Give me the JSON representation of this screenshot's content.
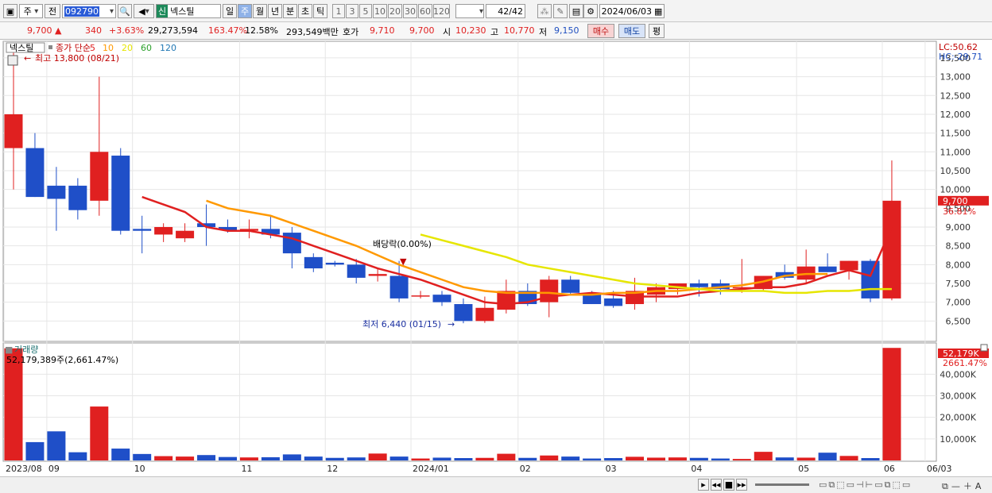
{
  "toolbar": {
    "mode": "주",
    "prev_label": "전",
    "code": "092790",
    "badge": "신",
    "name": "넥스틸",
    "periods": [
      "일",
      "주",
      "월",
      "년",
      "분",
      "초",
      "틱"
    ],
    "active_period": "주",
    "numbers": [
      "1",
      "3",
      "5",
      "10",
      "20",
      "30",
      "60",
      "120"
    ],
    "count": "42",
    "count_total": "/42",
    "date": "2024/06/03"
  },
  "quote": {
    "price": "9,700",
    "change": "340",
    "change_pct": "+3.63%",
    "volume": "29,273,594",
    "vol_ratio": "163.47%",
    "turnover": "12.58%",
    "amount": "293,549백만",
    "hoga_label": "호가",
    "hoga1": "9,710",
    "hoga2": "9,700",
    "open_label": "시",
    "open": "10,230",
    "high_label": "고",
    "high": "10,770",
    "low_label": "저",
    "low": "9,150",
    "buy": "매수",
    "sell": "매도",
    "eval": "평"
  },
  "legend": {
    "name": "넥스틸",
    "ma_label": "종가 단순",
    "ma_periods": [
      "5",
      "10",
      "20",
      "60",
      "120"
    ],
    "ma_colors": [
      "#e02020",
      "#ff9900",
      "#e6e600",
      "#2ca02c",
      "#1f77b4"
    ],
    "high_note": "최고 13,800 (08/21)",
    "low_note": "최저 6,440 (01/15)",
    "dividend": "배당락(0.00%)",
    "lc": "LC:50.62",
    "hc": "HC:-29.71",
    "last_price": "9,700",
    "last_pct": "36.81%"
  },
  "volume_panel": {
    "title": "거래량",
    "value": "52,179,389주(2,661.47%)",
    "last": "52,179K",
    "last_pct": "2661.47%"
  },
  "chart_data": {
    "type": "candlestick",
    "price_ticks": [
      "13,500",
      "13,000",
      "12,500",
      "12,000",
      "11,500",
      "11,000",
      "10,500",
      "10,000",
      "9,500",
      "9,000",
      "8,500",
      "8,000",
      "7,500",
      "7,000",
      "6,500"
    ],
    "price_values": [
      13500,
      13000,
      12500,
      12000,
      11500,
      11000,
      10500,
      10000,
      9500,
      9000,
      8500,
      8000,
      7500,
      7000,
      6500
    ],
    "ylim": [
      6000,
      13900
    ],
    "vol_ticks": [
      "40,000K",
      "30,000K",
      "20,000K",
      "10,000K"
    ],
    "vol_values": [
      40000,
      30000,
      20000,
      10000
    ],
    "vol_max": 53000,
    "x_labels": [
      {
        "i": 0,
        "t": "2023/08"
      },
      {
        "i": 2,
        "t": "09"
      },
      {
        "i": 6,
        "t": "10"
      },
      {
        "i": 11,
        "t": "11"
      },
      {
        "i": 15,
        "t": "12"
      },
      {
        "i": 19,
        "t": "2024/01"
      },
      {
        "i": 24,
        "t": "02"
      },
      {
        "i": 28,
        "t": "03"
      },
      {
        "i": 32,
        "t": "04"
      },
      {
        "i": 37,
        "t": "05"
      },
      {
        "i": 41,
        "t": "06"
      },
      {
        "i": 43,
        "t": "06/03"
      }
    ],
    "candles": [
      {
        "o": 11100,
        "h": 13800,
        "l": 10000,
        "c": 12000,
        "v": 52000
      },
      {
        "o": 11100,
        "h": 11500,
        "l": 9800,
        "c": 9800,
        "v": 8500
      },
      {
        "o": 10100,
        "h": 10600,
        "l": 8900,
        "c": 9750,
        "v": 13500
      },
      {
        "o": 10100,
        "h": 10300,
        "l": 9200,
        "c": 9450,
        "v": 3800
      },
      {
        "o": 9700,
        "h": 13000,
        "l": 9300,
        "c": 11000,
        "v": 25000
      },
      {
        "o": 10900,
        "h": 11100,
        "l": 8800,
        "c": 8900,
        "v": 5500
      },
      {
        "o": 8950,
        "h": 9300,
        "l": 8300,
        "c": 8900,
        "v": 3000
      },
      {
        "o": 8800,
        "h": 9100,
        "l": 8600,
        "c": 9000,
        "v": 2000
      },
      {
        "o": 8700,
        "h": 9100,
        "l": 8600,
        "c": 8900,
        "v": 1800
      },
      {
        "o": 9100,
        "h": 9600,
        "l": 8500,
        "c": 9000,
        "v": 2500
      },
      {
        "o": 9000,
        "h": 9200,
        "l": 8850,
        "c": 8920,
        "v": 1600
      },
      {
        "o": 8900,
        "h": 9200,
        "l": 8700,
        "c": 8950,
        "v": 1400
      },
      {
        "o": 8950,
        "h": 9300,
        "l": 8700,
        "c": 8800,
        "v": 1500
      },
      {
        "o": 8850,
        "h": 9000,
        "l": 7900,
        "c": 8300,
        "v": 2800
      },
      {
        "o": 8200,
        "h": 8300,
        "l": 7800,
        "c": 7900,
        "v": 1800
      },
      {
        "o": 8050,
        "h": 8100,
        "l": 7950,
        "c": 8000,
        "v": 1200
      },
      {
        "o": 8000,
        "h": 8150,
        "l": 7500,
        "c": 7650,
        "v": 1400
      },
      {
        "o": 7700,
        "h": 7900,
        "l": 7550,
        "c": 7750,
        "v": 3200
      },
      {
        "o": 7700,
        "h": 8100,
        "l": 7000,
        "c": 7100,
        "v": 1800
      },
      {
        "o": 7150,
        "h": 7300,
        "l": 7100,
        "c": 7180,
        "v": 900
      },
      {
        "o": 7200,
        "h": 7300,
        "l": 6900,
        "c": 7000,
        "v": 1300
      },
      {
        "o": 6950,
        "h": 7100,
        "l": 6440,
        "c": 6500,
        "v": 1100
      },
      {
        "o": 6500,
        "h": 7150,
        "l": 6450,
        "c": 6850,
        "v": 1200
      },
      {
        "o": 6800,
        "h": 7600,
        "l": 6700,
        "c": 7300,
        "v": 3100
      },
      {
        "o": 7300,
        "h": 7500,
        "l": 6900,
        "c": 6950,
        "v": 1200
      },
      {
        "o": 7000,
        "h": 7700,
        "l": 6600,
        "c": 7600,
        "v": 2300
      },
      {
        "o": 7600,
        "h": 7700,
        "l": 7200,
        "c": 7250,
        "v": 1800
      },
      {
        "o": 7200,
        "h": 7300,
        "l": 6950,
        "c": 6950,
        "v": 900
      },
      {
        "o": 7100,
        "h": 7300,
        "l": 6850,
        "c": 6900,
        "v": 1100
      },
      {
        "o": 6950,
        "h": 7650,
        "l": 6800,
        "c": 7300,
        "v": 1700
      },
      {
        "o": 7200,
        "h": 7500,
        "l": 7000,
        "c": 7400,
        "v": 1300
      },
      {
        "o": 7350,
        "h": 7500,
        "l": 7200,
        "c": 7500,
        "v": 1400
      },
      {
        "o": 7500,
        "h": 7600,
        "l": 7150,
        "c": 7400,
        "v": 1200
      },
      {
        "o": 7500,
        "h": 7600,
        "l": 7200,
        "c": 7350,
        "v": 900
      },
      {
        "o": 7400,
        "h": 8150,
        "l": 7250,
        "c": 7400,
        "v": 700
      },
      {
        "o": 7350,
        "h": 7700,
        "l": 7300,
        "c": 7700,
        "v": 4000
      },
      {
        "o": 7800,
        "h": 8000,
        "l": 7600,
        "c": 7650,
        "v": 1400
      },
      {
        "o": 7600,
        "h": 8400,
        "l": 7500,
        "c": 7950,
        "v": 1300
      },
      {
        "o": 7950,
        "h": 8300,
        "l": 7800,
        "c": 7800,
        "v": 3600
      },
      {
        "o": 7850,
        "h": 8100,
        "l": 7600,
        "c": 8100,
        "v": 2100
      },
      {
        "o": 8100,
        "h": 8150,
        "l": 7000,
        "c": 7100,
        "v": 1100
      },
      {
        "o": 7100,
        "h": 10770,
        "l": 7050,
        "c": 9700,
        "v": 52179
      }
    ],
    "ma_lines": [
      {
        "period": "5",
        "color": "#e02020",
        "start": 6,
        "values": [
          9800,
          9600,
          9400,
          9000,
          8900,
          8900,
          8800,
          8700,
          8500,
          8300,
          8100,
          7900,
          7750,
          7600,
          7400,
          7200,
          7000,
          6950,
          7000,
          7150,
          7200,
          7250,
          7200,
          7150,
          7150,
          7150,
          7250,
          7300,
          7350,
          7400,
          7400,
          7500,
          7700,
          7850,
          7700,
          9000
        ]
      },
      {
        "period": "10",
        "color": "#ff9900",
        "start": 9,
        "values": [
          9700,
          9500,
          9400,
          9300,
          9100,
          8900,
          8700,
          8500,
          8250,
          8000,
          7800,
          7600,
          7400,
          7300,
          7250,
          7250,
          7250,
          7200,
          7200,
          7250,
          7250,
          7300,
          7300,
          7350,
          7400,
          7450,
          7550,
          7700,
          7750,
          7750
        ]
      },
      {
        "period": "20",
        "color": "#e6e600",
        "start": 19,
        "values": [
          8800,
          8650,
          8500,
          8350,
          8200,
          8000,
          7900,
          7800,
          7700,
          7600,
          7500,
          7450,
          7400,
          7350,
          7300,
          7300,
          7300,
          7250,
          7250,
          7300,
          7300,
          7350,
          7350
        ]
      }
    ],
    "series": [
      {
        "name": "넥스틸"
      },
      {
        "name": "거래량"
      }
    ]
  }
}
